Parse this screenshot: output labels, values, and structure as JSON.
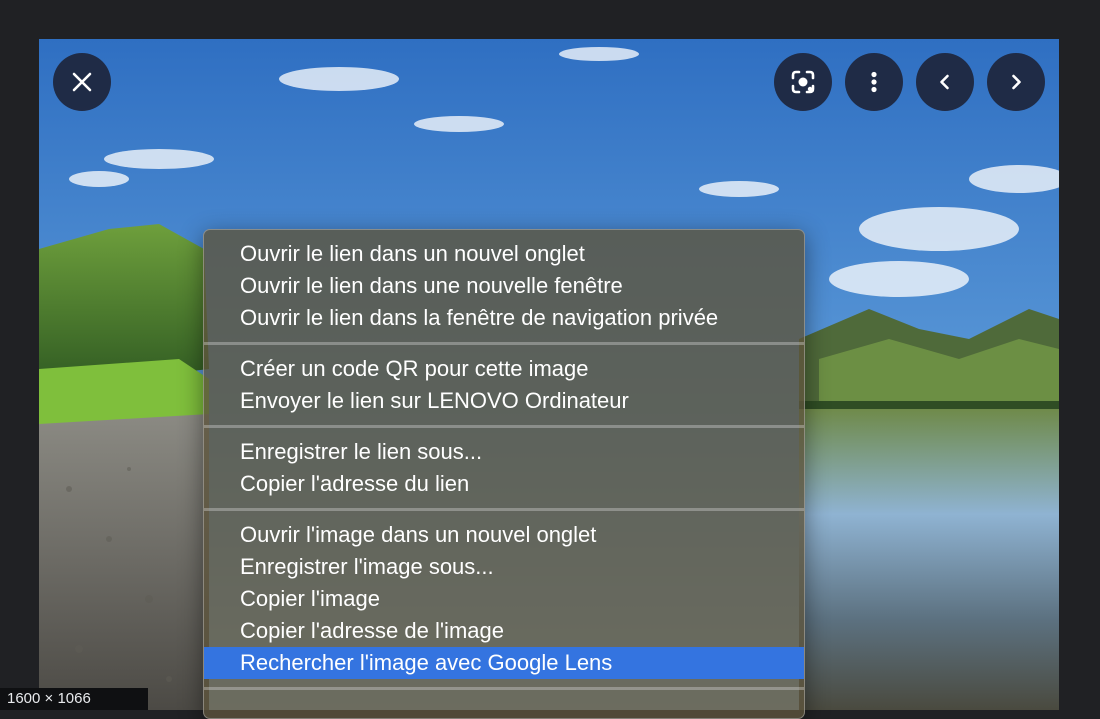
{
  "viewer": {
    "image_dimensions": "1600 × 1066",
    "controls": {
      "close_icon": "close-icon",
      "lens_icon": "google-lens-icon",
      "more_icon": "more-vert-icon",
      "prev_icon": "chevron-left-icon",
      "next_icon": "chevron-right-icon"
    }
  },
  "context_menu": {
    "groups": [
      [
        "Ouvrir le lien dans un nouvel onglet",
        "Ouvrir le lien dans une nouvelle fenêtre",
        "Ouvrir le lien dans la fenêtre de navigation privée"
      ],
      [
        "Créer un code QR pour cette image",
        "Envoyer le lien sur LENOVO Ordinateur"
      ],
      [
        "Enregistrer le lien sous...",
        "Copier l'adresse du lien"
      ],
      [
        "Ouvrir l'image dans un nouvel onglet",
        "Enregistrer l'image sous...",
        "Copier l'image",
        "Copier l'adresse de l'image",
        "Rechercher l'image avec Google Lens"
      ]
    ],
    "highlighted_item": "Rechercher l'image avec Google Lens",
    "colors": {
      "highlight": "#3474e0",
      "text": "#ffffff"
    }
  }
}
